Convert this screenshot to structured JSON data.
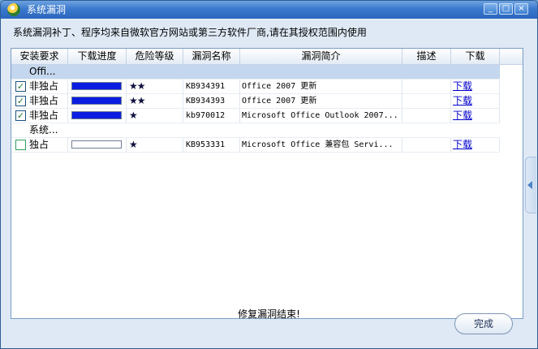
{
  "window": {
    "title": "系统漏洞",
    "minimize": "_",
    "maximize": "□",
    "close": "×"
  },
  "description": "系统漏洞补丁、程序均来自微软官方网站或第三方软件厂商,请在其授权范围内使用",
  "columns": [
    "安装要求",
    "下载进度",
    "危险等级",
    "漏洞名称",
    "漏洞简介",
    "描述",
    "下载"
  ],
  "groups": [
    {
      "name": "Offi...",
      "rows": [
        {
          "checked": true,
          "requirement": "非独占",
          "progress": 1.0,
          "stars": "★★",
          "kb": "KB934391",
          "intro": "Office 2007 更新",
          "desc": "",
          "link": "下载"
        },
        {
          "checked": true,
          "requirement": "非独占",
          "progress": 1.0,
          "stars": "★★",
          "kb": "KB934393",
          "intro": "Office 2007 更新",
          "desc": "",
          "link": "下载"
        },
        {
          "checked": true,
          "requirement": "非独占",
          "progress": 1.0,
          "stars": "★",
          "kb": "kb970012",
          "intro": "Microsoft Office Outlook 2007...",
          "desc": "",
          "link": "下载"
        }
      ]
    },
    {
      "name": "系统...",
      "rows": [
        {
          "checked": false,
          "requirement": "独占",
          "progress": 0.0,
          "stars": "★",
          "kb": "KB953331",
          "intro": "Microsoft Office 兼容包 Servi...",
          "desc": "",
          "link": "下载"
        }
      ]
    }
  ],
  "finish_message": "修复漏洞结束!",
  "finish_button": "完成",
  "colors": {
    "titlebar": "#3a79cd",
    "progress": "#0a1de0",
    "group_bg": "#c5d7ee",
    "link": "#0000cc"
  },
  "icons": [
    "app-shield-icon",
    "checkbox-checked-icon",
    "checkbox-unchecked-icon",
    "star-icon",
    "collapse-arrow-icon"
  ]
}
